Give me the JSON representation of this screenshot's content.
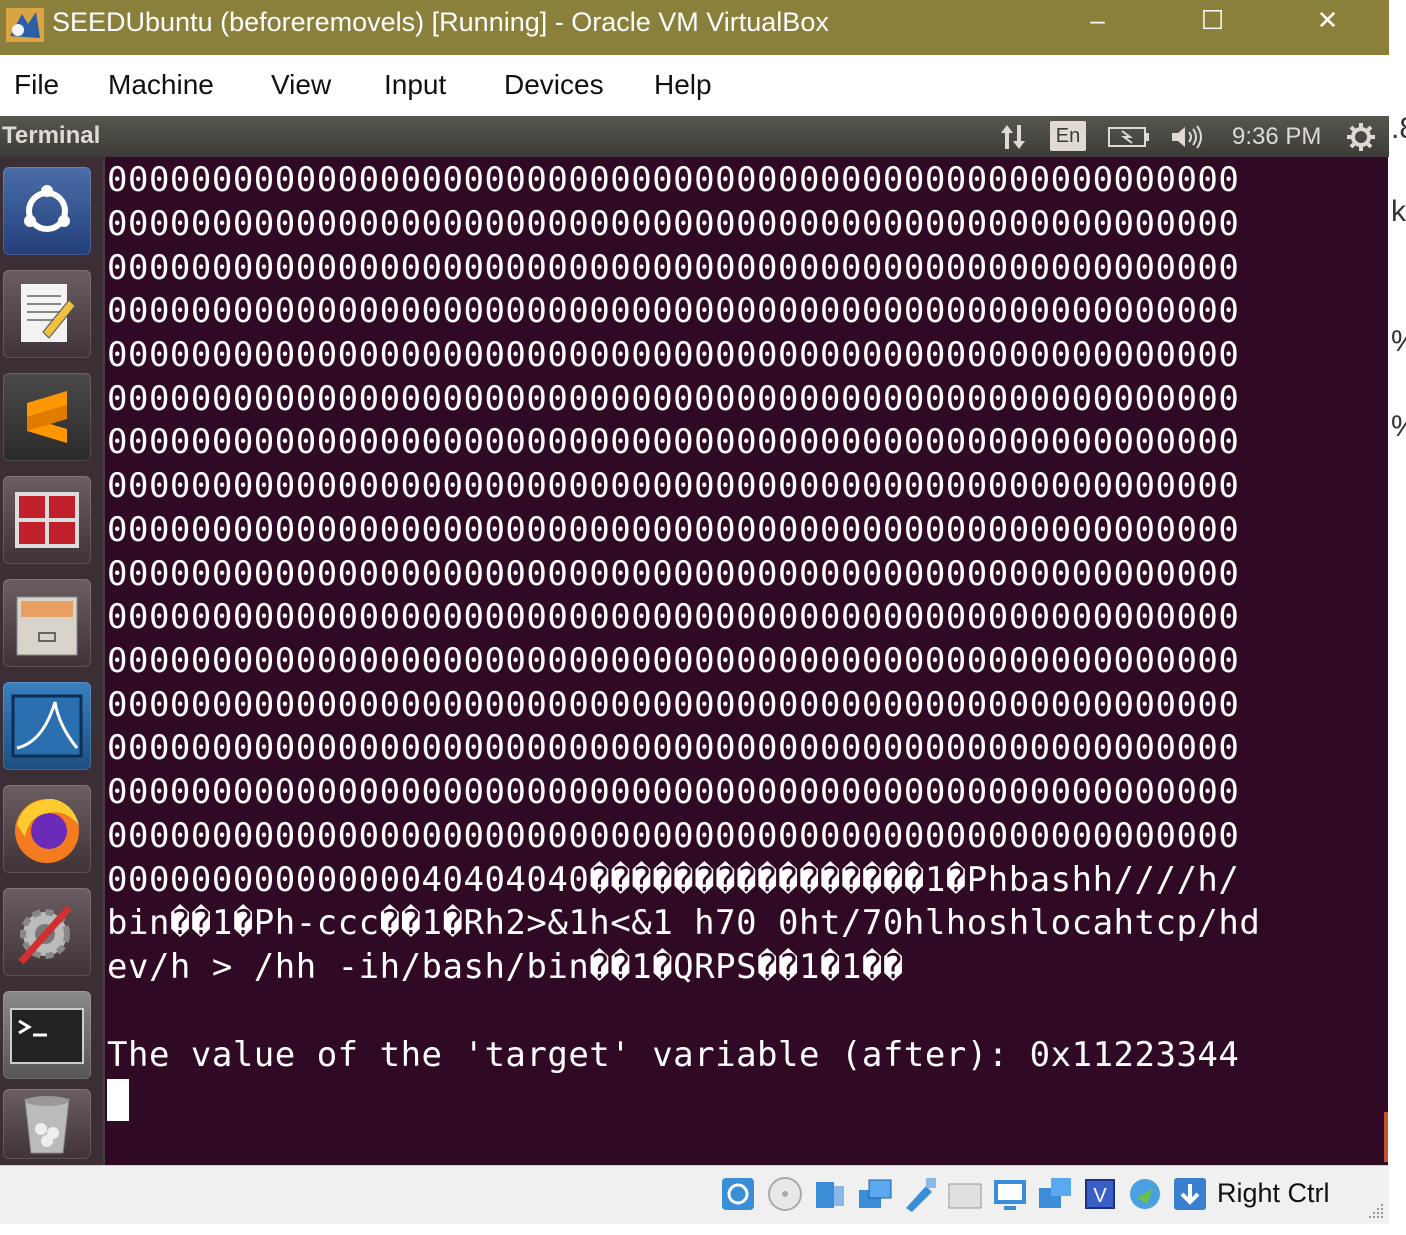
{
  "window": {
    "title": "SEEDUbuntu (beforeremovels) [Running] - Oracle VM VirtualBox",
    "controls": {
      "minimize": "–",
      "maximize": "☐",
      "close": "✕"
    }
  },
  "menu": [
    "File",
    "Machine",
    "View",
    "Input",
    "Devices",
    "Help"
  ],
  "panel": {
    "app_title": "Terminal",
    "keyboard_layout": "En",
    "clock": "9:36 PM"
  },
  "launcher": {
    "items": [
      {
        "name": "ubuntu-dash-icon"
      },
      {
        "name": "text-editor-icon"
      },
      {
        "name": "sublime-text-icon"
      },
      {
        "name": "terminal-grid-icon"
      },
      {
        "name": "file-manager-icon"
      },
      {
        "name": "wireshark-icon"
      },
      {
        "name": "firefox-icon"
      },
      {
        "name": "system-settings-icon"
      },
      {
        "name": "terminal-icon"
      },
      {
        "name": "trash-icon"
      }
    ]
  },
  "terminal": {
    "lines": [
      "000000000000000000000000000000000000000000000000000000",
      "000000000000000000000000000000000000000000000000000000",
      "000000000000000000000000000000000000000000000000000000",
      "000000000000000000000000000000000000000000000000000000",
      "000000000000000000000000000000000000000000000000000000",
      "000000000000000000000000000000000000000000000000000000",
      "000000000000000000000000000000000000000000000000000000",
      "000000000000000000000000000000000000000000000000000000",
      "000000000000000000000000000000000000000000000000000000",
      "000000000000000000000000000000000000000000000000000000",
      "000000000000000000000000000000000000000000000000000000",
      "000000000000000000000000000000000000000000000000000000",
      "000000000000000000000000000000000000000000000000000000",
      "000000000000000000000000000000000000000000000000000000",
      "000000000000000000000000000000000000000000000000000000",
      "000000000000000000000000000000000000000000000000000000",
      "00000000000000040404040����������������1�Phbashh////h/",
      "bin��1�Ph-ccc��1�Rh2>&1h<&1 h70 0ht/70hlhoshlocahtcp/hd",
      "ev/h > /hh -ih/bash/bin��1�QRPS��1�1��",
      "",
      "The value of the 'target' variable (after): 0x11223344"
    ]
  },
  "right_edge_chars": [
    ".8",
    "k%",
    "%",
    "%"
  ],
  "statusbar": {
    "host_key": "Right Ctrl",
    "icons": [
      "hard-disk-icon",
      "optical-drive-icon",
      "audio-icon",
      "network-icon",
      "usb-icon",
      "shared-folder-icon",
      "display-icon",
      "screen-capture-icon",
      "virtualization-icon",
      "mouse-integration-icon",
      "keyboard-capture-icon"
    ]
  }
}
